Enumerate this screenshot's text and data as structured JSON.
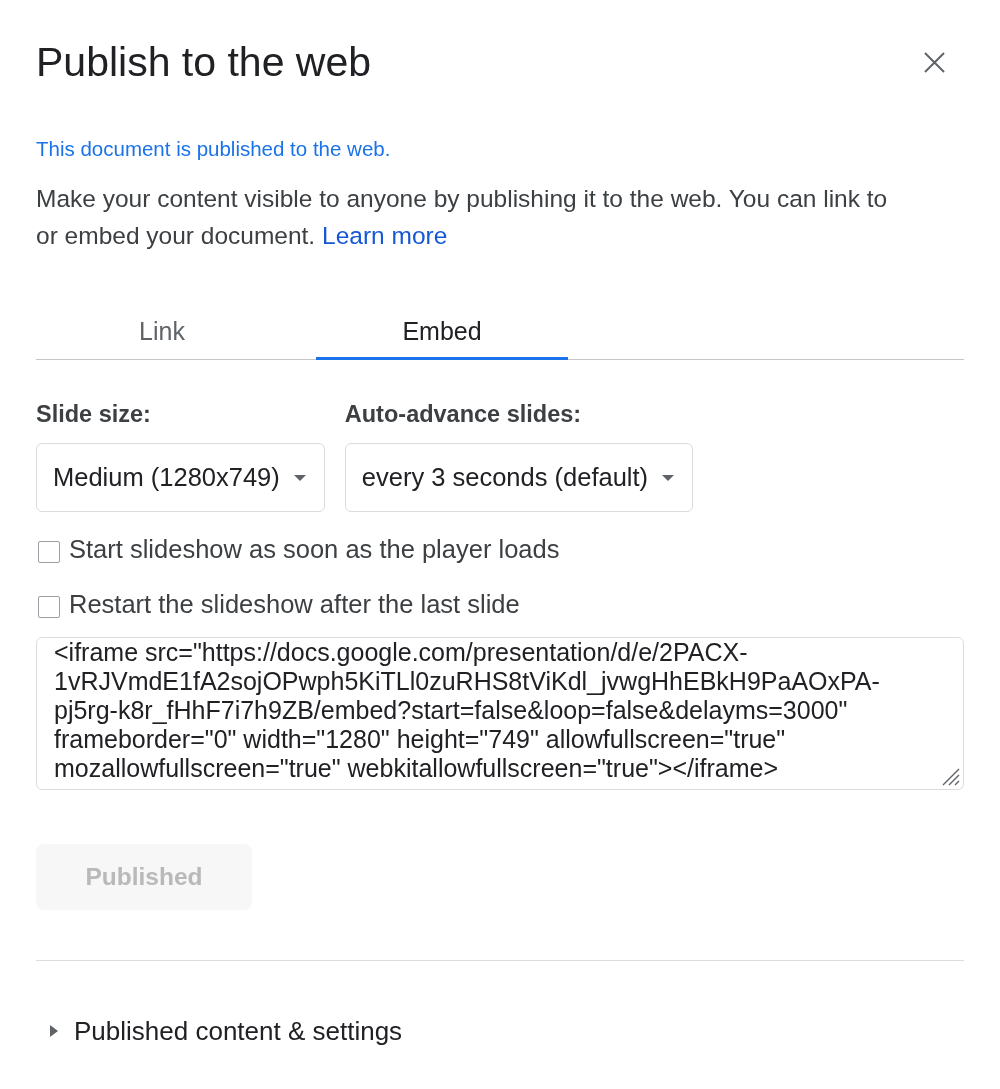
{
  "dialog": {
    "title": "Publish to the web"
  },
  "status": "This document is published to the web.",
  "description": {
    "text": "Make your content visible to anyone by publishing it to the web. You can link to or embed your document.",
    "link": "Learn more"
  },
  "tabs": [
    {
      "label": "Link",
      "selected": false
    },
    {
      "label": "Embed",
      "selected": true
    }
  ],
  "selects": [
    {
      "label": "Slide size:",
      "value": "Medium (1280x749)"
    },
    {
      "label": "Auto-advance slides:",
      "value": "every 3 seconds (default)"
    }
  ],
  "options": [
    {
      "label": "Start slideshow as soon as the player loads",
      "checked": false
    },
    {
      "label": "Restart the slideshow after the last slide",
      "checked": false
    }
  ],
  "embed_code": "<iframe src=\"https://docs.google.com/presentation/d/e/2PACX-1vRJVmdE1fA2sojOPwph5KiTLl0zuRHS8tViKdl_jvwgHhEBkH9PaAOxPA-pj5rg-k8r_fHhF7i7h9ZB/embed?start=false&loop=false&delayms=3000\" frameborder=\"0\" width=\"1280\" height=\"749\" allowfullscreen=\"true\" mozallowfullscreen=\"true\" webkitallowfullscreen=\"true\"></iframe>",
  "publish_button": {
    "label": "Published",
    "disabled": true
  },
  "published_settings": {
    "label": "Published content & settings",
    "expanded": false
  }
}
